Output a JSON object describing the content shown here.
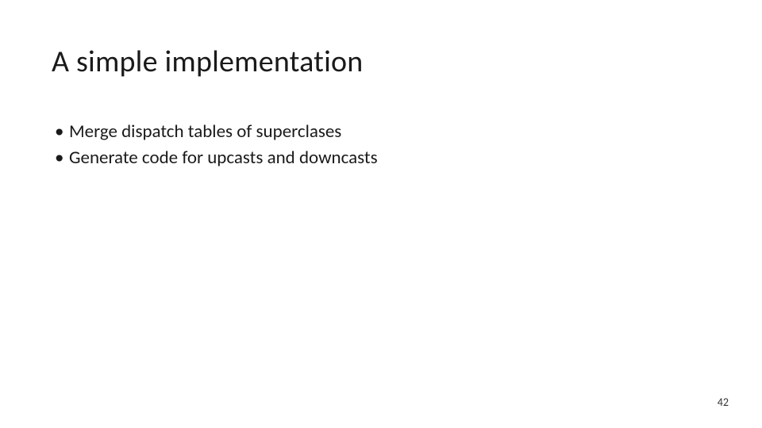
{
  "slide": {
    "title": "A simple implementation",
    "bullets": [
      "Merge dispatch tables of superclases",
      "Generate code for upcasts and downcasts"
    ],
    "pageNumber": "42"
  }
}
